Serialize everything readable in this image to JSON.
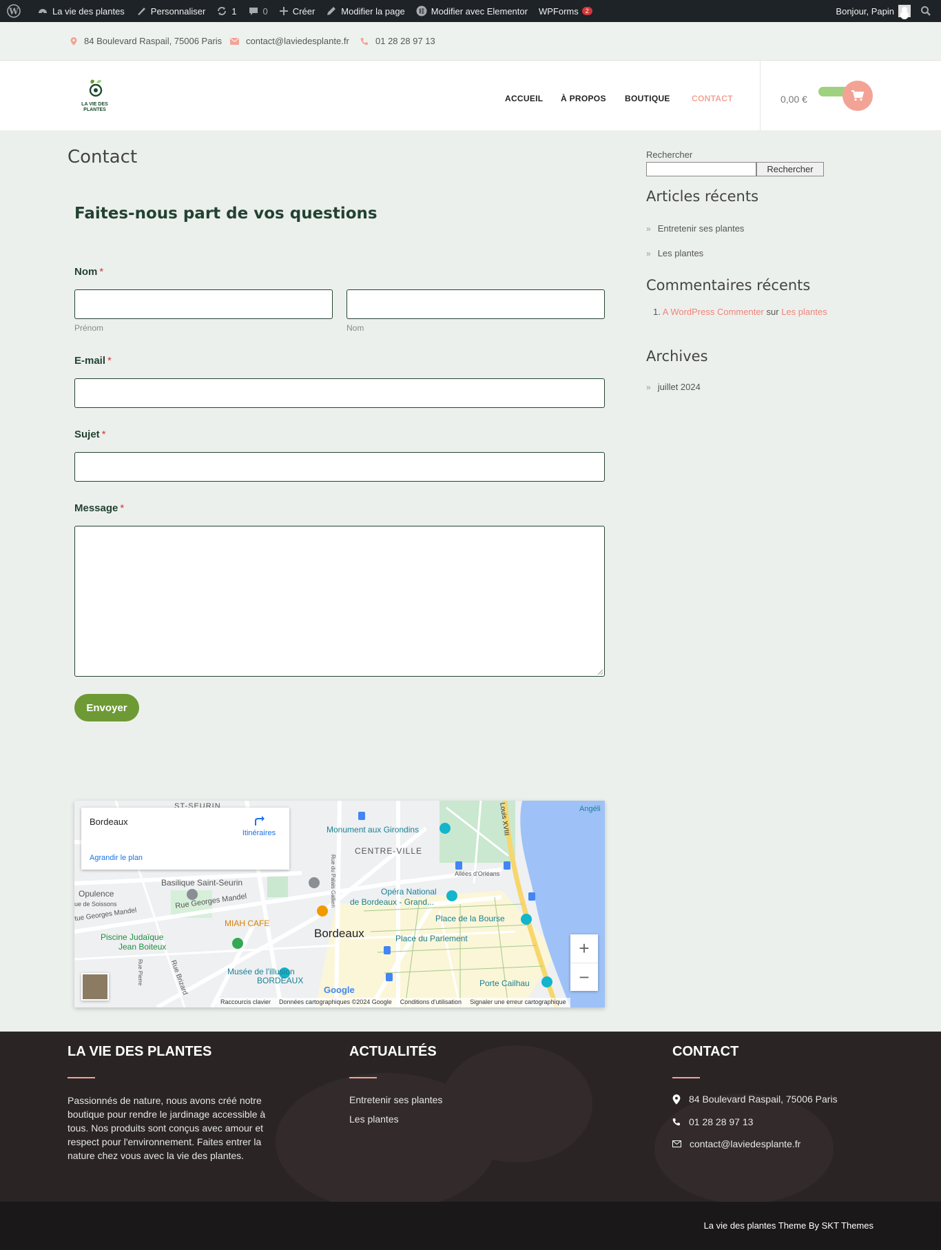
{
  "adminbar": {
    "site_name": "La vie des plantes",
    "customize": "Personnaliser",
    "updates_count": "1",
    "comments_count": "0",
    "create": "Créer",
    "edit_page": "Modifier la page",
    "edit_elementor": "Modifier avec Elementor",
    "wpforms": "WPForms",
    "wpforms_badge": "2",
    "greeting": "Bonjour, Papin"
  },
  "topbar": {
    "address": "84 Boulevard Raspail, 75006 Paris",
    "email": "contact@laviedesplante.fr",
    "phone": "01 28 28 97 13"
  },
  "header": {
    "logo_line1": "LA VIE DES",
    "logo_line2": "PLANTES",
    "nav": [
      "ACCUEIL",
      "À PROPOS",
      "BOUTIQUE",
      "CONTACT"
    ],
    "active_nav": "CONTACT",
    "cart_total": "0,00 €"
  },
  "page": {
    "title": "Contact",
    "form_heading": "Faites-nous part de vos questions",
    "name_label": "Nom",
    "first_sublabel": "Prénom",
    "last_sublabel": "Nom",
    "email_label": "E-mail",
    "subject_label": "Sujet",
    "message_label": "Message",
    "required_mark": "*",
    "submit": "Envoyer"
  },
  "map": {
    "place": "Bordeaux",
    "directions": "Itinéraires",
    "enlarge": "Agrandir le plan",
    "zoom_in": "+",
    "zoom_out": "−",
    "attrib": [
      "Raccourcis clavier",
      "Données cartographiques ©2024 Google",
      "Conditions d'utilisation",
      "Signaler une erreur cartographique"
    ],
    "labels": {
      "saint_seurin": "ST-SEURIN",
      "girondins": "Monument aux Girondins",
      "centre": "CENTRE-VILLE",
      "louis": "Louis XVIII",
      "angeli": "Angéli",
      "allees": "Allées d'Orléans",
      "basilique": "Basilique Saint-Seurin",
      "opulence": "Opulence",
      "soissons": "ue de Soissons",
      "rue_mandel": "Rue Georges Mandel",
      "rue_mandel2": "tue Georges Mandel",
      "opera1": "Opéra National",
      "opera2": "de Bordeaux - Grand...",
      "gallien": "Rue du Palais Gallien",
      "miah": "MIAH CAFE",
      "bordeaux": "Bordeaux",
      "bourse": "Place de la Bourse",
      "parlement": "Place du Parlement",
      "piscine1": "Piscine Judaïque",
      "piscine2": "Jean Boiteux",
      "brizard": "Rue Brizard",
      "pierre": "Rue Pierre",
      "illusion1": "Musée de l'illusion",
      "illusion2": "BORDEAUX",
      "cailhau": "Porte Cailhau",
      "google": "Google"
    },
    "colors": {
      "water": "#9ec2f7",
      "road": "#ffffff",
      "park": "#c9e8cf",
      "yellow_road": "#f7d66c",
      "poi_teal": "#12b5cb",
      "poi_green": "#34a853",
      "poi_orange": "#f29900"
    }
  },
  "sidebar": {
    "search_label": "Rechercher",
    "search_button": "Rechercher",
    "recent_posts_title": "Articles récents",
    "recent_posts": [
      "Entretenir ses plantes",
      "Les plantes"
    ],
    "recent_comments_title": "Commentaires récents",
    "comment_num": "1.",
    "comment_author": "A WordPress Commenter",
    "comment_on": "sur",
    "comment_post": "Les plantes",
    "archives_title": "Archives",
    "archives": [
      "juillet 2024"
    ]
  },
  "footer": {
    "col1_title": "LA VIE DES PLANTES",
    "col1_text": "Passionnés de nature, nous avons créé notre boutique pour rendre le jardinage accessible à tous. Nos produits sont conçus avec amour et respect pour l'environnement. Faites entrer la nature chez vous avec la vie des plantes.",
    "col2_title": "ACTUALITÉS",
    "col2_links": [
      "Entretenir ses plantes",
      "Les plantes"
    ],
    "col3_title": "CONTACT",
    "address": "84 Boulevard Raspail, 75006 Paris",
    "phone": "01 28 28 97 13",
    "email": "contact@laviedesplante.fr",
    "credit": "La vie des plantes Theme By SKT Themes"
  },
  "colors": {
    "accent": "#f3a396",
    "brand_green": "#234232",
    "button_green": "#6e9a35",
    "link_pink": "#f0837b"
  }
}
